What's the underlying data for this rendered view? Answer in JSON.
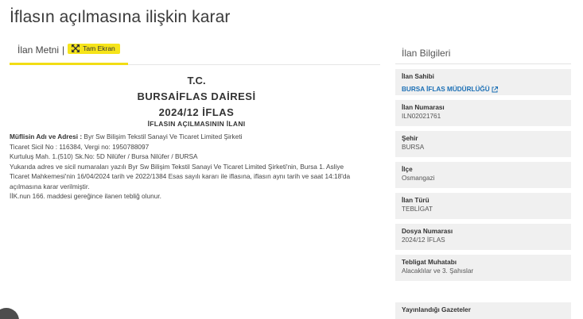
{
  "page": {
    "title": "İflasın açılmasına ilişkin karar"
  },
  "tabs": {
    "active_label": "İlan Metni",
    "separator": "|",
    "fullscreen_label": "Tam Ekran"
  },
  "document": {
    "tc": "T.C.",
    "office": "BURSAİFLAS DAİRESİ",
    "file_no": "2024/12 İFLAS",
    "subtitle": "İFLASIN AÇILMASININ İLANI",
    "debtor_label": "Müflisin Adı ve Adresi :",
    "debtor_value": " Byr Sw Bilişim Tekstil Sanayi Ve Ticaret Limited Şirketi",
    "lines": [
      "Ticaret Sicil No : 116384, Vergi no: 1950788097",
      "Kurtuluş Mah. 1.(510) Sk.No: 5D Nilüfer / Bursa Nilüfer / BURSA",
      "Yukarıda adres ve sicil numaraları yazılı Byr Sw Bilişim Tekstil Sanayi Ve Ticaret Limited Şirketi'nin, Bursa 1. Asliye",
      "Ticaret Mahkemesi'nin 16/04/2024 tarih ve 2022/1384 Esas sayılı kararı ile iflasına, iflasın aynı tarih ve saat 14:18'da",
      "açılmasına karar verilmiştir.",
      "İİK.nun 166. maddesi gereğince ilanen tebliğ olunur."
    ]
  },
  "sidebar": {
    "title": "İlan Bilgileri",
    "owner": {
      "label": "İlan Sahibi",
      "value": "BURSA İFLAS MÜDÜRLÜĞÜ"
    },
    "items": [
      {
        "label": "İlan Numarası",
        "value": "ILN02021761"
      },
      {
        "label": "Şehir",
        "value": "BURSA"
      },
      {
        "label": "İlçe",
        "value": "Osmangazi"
      },
      {
        "label": "İlan Türü",
        "value": "TEBLİGAT"
      },
      {
        "label": "Dosya Numarası",
        "value": "2024/12 İFLAS"
      },
      {
        "label": "Tebligat Muhatabı",
        "value": "Alacaklılar ve 3. Şahıslar"
      }
    ],
    "newspapers": {
      "label": "Yayınlandığı Gazeteler"
    }
  },
  "colors": {
    "accent": "#f6e41a",
    "link": "#1b6fb5",
    "panel_bg": "#f0f0f0"
  },
  "icons": {
    "fullscreen": "expand-arrows-icon",
    "external": "external-link-icon"
  }
}
